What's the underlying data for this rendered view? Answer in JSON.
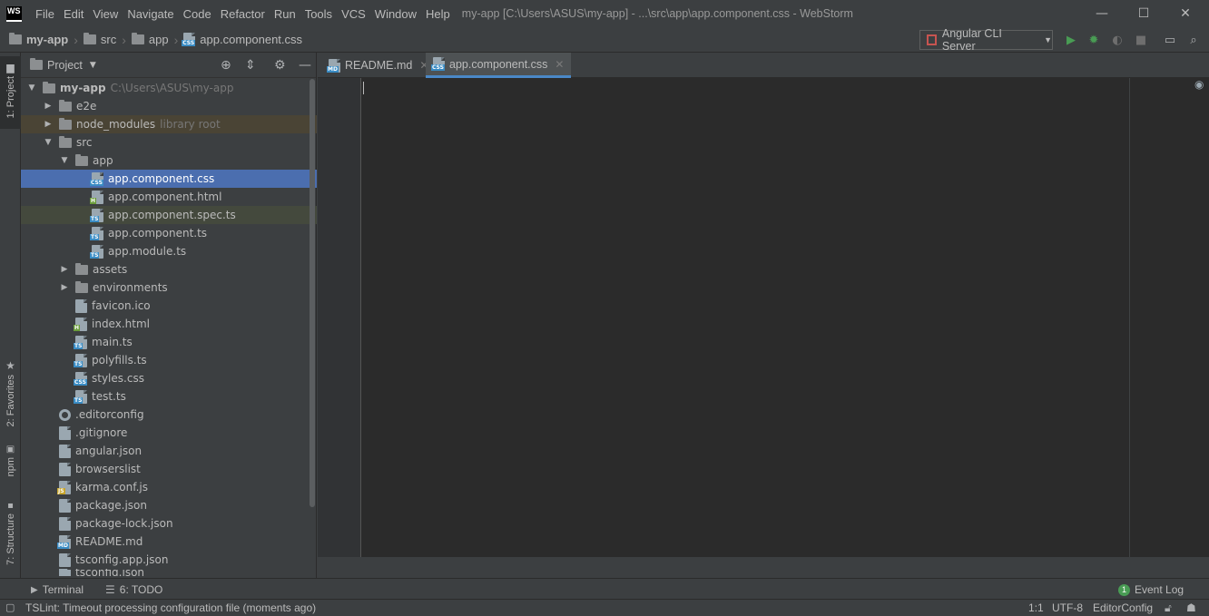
{
  "window": {
    "title": "my-app [C:\\Users\\ASUS\\my-app] - ...\\src\\app\\app.component.css - WebStorm",
    "logo_text": "WS",
    "controls": [
      "—",
      "☐",
      "✕"
    ]
  },
  "menu": [
    "File",
    "Edit",
    "View",
    "Navigate",
    "Code",
    "Refactor",
    "Run",
    "Tools",
    "VCS",
    "Window",
    "Help"
  ],
  "breadcrumb": [
    "my-app",
    "src",
    "app",
    "app.component.css"
  ],
  "toolbar": {
    "run_config": "Angular CLI Server",
    "colors": {
      "run": "#499c54",
      "debug": "#499c54",
      "config_icon": "#c75450"
    }
  },
  "left_stripe": {
    "project": "1: Project",
    "favorites": "2: Favorites",
    "npm": "npm",
    "structure": "7: Structure"
  },
  "project_panel": {
    "title": "Project",
    "tree": [
      {
        "label": "my-app",
        "hint": "C:\\Users\\ASUS\\my-app",
        "type": "folder",
        "expanded": true
      },
      {
        "label": "e2e",
        "type": "folder",
        "expanded": false
      },
      {
        "label": "node_modules",
        "hint": "library root",
        "type": "folder",
        "expanded": false
      },
      {
        "label": "src",
        "type": "folder",
        "expanded": true
      },
      {
        "label": "app",
        "type": "folder",
        "expanded": true
      },
      {
        "label": "app.component.css",
        "type": "css",
        "selected": true
      },
      {
        "label": "app.component.html",
        "type": "html"
      },
      {
        "label": "app.component.spec.ts",
        "type": "ts"
      },
      {
        "label": "app.component.ts",
        "type": "ts"
      },
      {
        "label": "app.module.ts",
        "type": "ts"
      },
      {
        "label": "assets",
        "type": "folder",
        "expanded": false
      },
      {
        "label": "environments",
        "type": "folder",
        "expanded": false
      },
      {
        "label": "favicon.ico",
        "type": "file"
      },
      {
        "label": "index.html",
        "type": "html"
      },
      {
        "label": "main.ts",
        "type": "ts"
      },
      {
        "label": "polyfills.ts",
        "type": "ts"
      },
      {
        "label": "styles.css",
        "type": "css"
      },
      {
        "label": "test.ts",
        "type": "ts"
      },
      {
        "label": ".editorconfig",
        "type": "config"
      },
      {
        "label": ".gitignore",
        "type": "file"
      },
      {
        "label": "angular.json",
        "type": "json"
      },
      {
        "label": "browserslist",
        "type": "file"
      },
      {
        "label": "karma.conf.js",
        "type": "js"
      },
      {
        "label": "package.json",
        "type": "json"
      },
      {
        "label": "package-lock.json",
        "type": "json"
      },
      {
        "label": "README.md",
        "type": "md"
      },
      {
        "label": "tsconfig.app.json",
        "type": "json"
      },
      {
        "label": "tsconfig.json",
        "type": "json"
      }
    ],
    "colors": {
      "selected_bg": "#4b6eaf",
      "library_bg": "#4a4435",
      "spec_bg": "#44493d"
    }
  },
  "editor_tabs": [
    {
      "label": "README.md",
      "icon": "MD",
      "active": false
    },
    {
      "label": "app.component.css",
      "icon": "CSS",
      "active": true
    }
  ],
  "bottom_tabs": {
    "terminal": "Terminal",
    "todo": "6: TODO",
    "event_log": "Event Log",
    "event_count": "1"
  },
  "status": {
    "message": "TSLint: Timeout processing configuration file (moments ago)",
    "position": "1:1",
    "encoding": "UTF-8",
    "editor_config": "EditorConfig"
  }
}
